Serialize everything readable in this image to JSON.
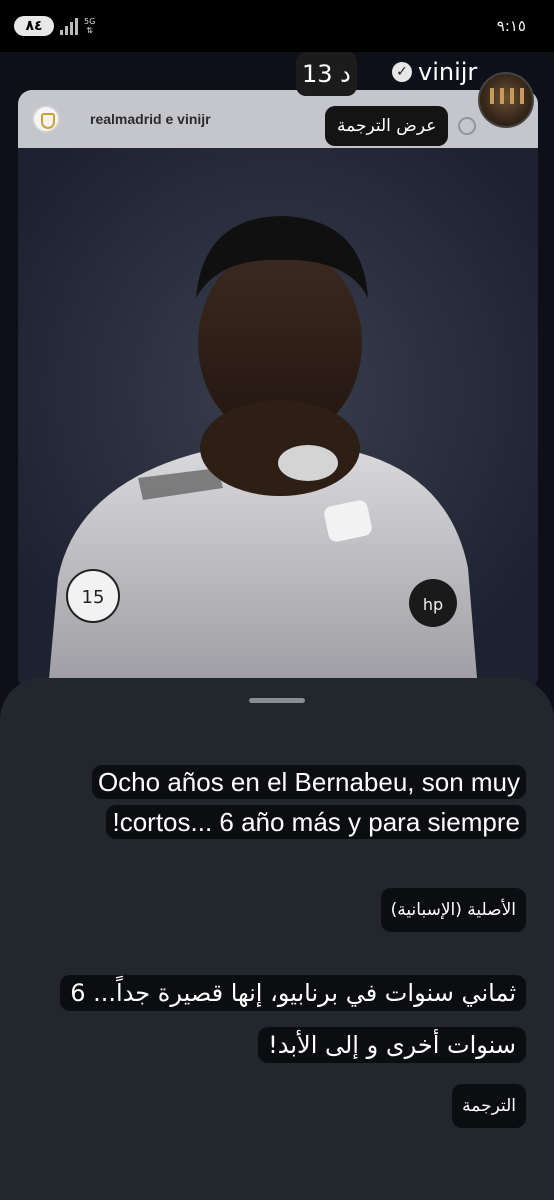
{
  "status_bar": {
    "battery": "٨٤",
    "network": "5G",
    "time": "٩:١٥"
  },
  "story": {
    "username": "vinijr",
    "verified_icon": "check",
    "time_ago": "13 د",
    "translate_button": "عرض الترجمة"
  },
  "post": {
    "authors": "realmadrid e vinijr"
  },
  "translation_sheet": {
    "original_text": "Ocho años en el Bernabeu, son muy cortos... 6 año más y para siempre!",
    "original_label": "الأصلية (الإسبانية)",
    "translated_text": "ثماني سنوات في برنابيو، إنها قصيرة جداً... 6 سنوات أخرى و إلى الأبد!",
    "translated_label": "الترجمة"
  },
  "colors": {
    "sheet_bg": "#22272e",
    "text_highlight": "#0c0d10",
    "post_header_bg": "#ebebf0"
  }
}
